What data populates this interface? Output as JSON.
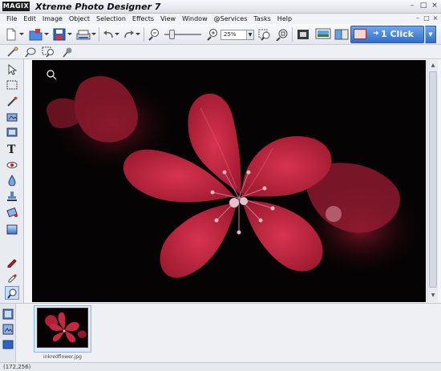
{
  "window": {
    "logo": "MAGIX",
    "title": "Xtreme Photo Designer 7",
    "controls": {
      "minimize": "–",
      "maximize": "□",
      "close": "×"
    }
  },
  "menu": {
    "items": [
      "File",
      "Edit",
      "Image",
      "Object",
      "Selection",
      "Effects",
      "View",
      "Window",
      "@Services",
      "Tasks",
      "Help"
    ]
  },
  "toolbar": {
    "zoom_value": "25%",
    "one_click_label": "1 Click",
    "icons": [
      "new-icon",
      "open-icon",
      "save-icon",
      "scan-icon",
      "undo-icon",
      "redo-icon",
      "zoom-out-icon",
      "zoom-slider",
      "zoom-in-icon",
      "zoom-fit-icon",
      "zoom-actual-icon",
      "crop-icon",
      "print-icon",
      "compare-icon"
    ]
  },
  "toolbar2": {
    "icons": [
      "magic-wand-icon",
      "lasso-icon",
      "zoom-region-icon",
      "pin-icon"
    ]
  },
  "tools": [
    "arrow-icon",
    "select-rect-icon",
    "brush-icon",
    "clone-icon",
    "image-icon",
    "text-icon",
    "red-eye-icon",
    "drop-icon",
    "stamp-icon",
    "fill-icon",
    "gradient-icon",
    "pen-icon",
    "dropper-icon",
    "magnify-icon"
  ],
  "tray": {
    "thumbnails": [
      {
        "filename": "inkredflower.jpg"
      }
    ]
  },
  "status": {
    "coordinates": "(172,256)"
  },
  "colors": {
    "accent": "#2f6fc7",
    "flower": "#c2243f",
    "background": "#060304"
  }
}
